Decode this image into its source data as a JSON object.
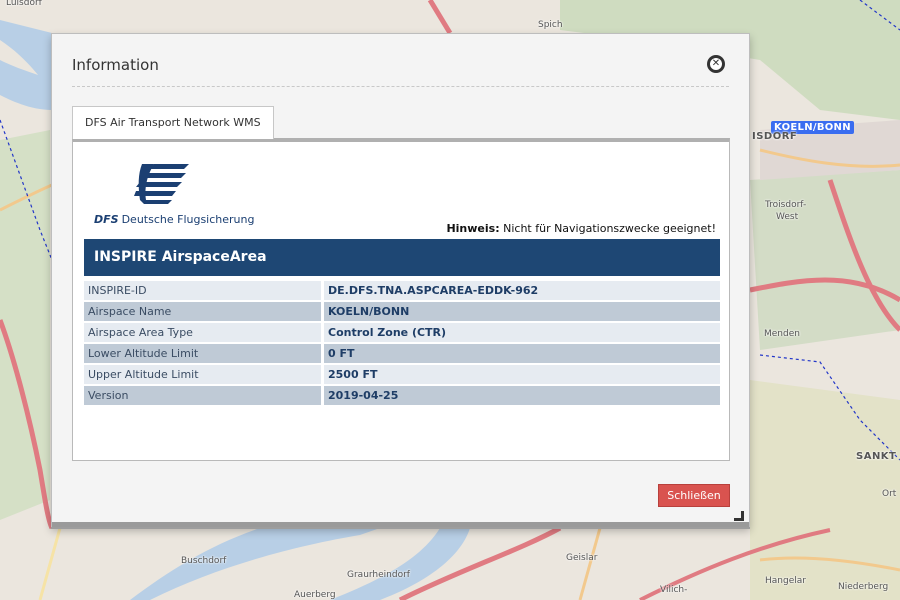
{
  "map": {
    "labels": {
      "luisdorf": "Luisdorf",
      "spich": "Spich",
      "koeln_bonn": "KOELN/BONN",
      "isdorf": "ISDORF",
      "troisdorf_west": "Troisdorf-",
      "troisdorf_west2": "West",
      "menden": "Menden",
      "sankt": "SANKT A",
      "ort": "Ort",
      "buschdorf": "Buschdorf",
      "graurheindorf": "Graurheindorf",
      "auerberg": "Auerberg",
      "geislar": "Geislar",
      "vilich": "Vilich-",
      "hangelar": "Hangelar",
      "niederberg": "Niederberg"
    }
  },
  "dialog": {
    "title": "Information",
    "tab_label": "DFS Air Transport Network WMS",
    "logo_text_bold": "DFS",
    "logo_text": "Deutsche Flugsicherung",
    "hint_label": "Hinweis:",
    "hint_text": " Nicht für Navigationszwecke geeignet!",
    "header": "INSPIRE AirspaceArea",
    "rows": [
      {
        "key": "INSPIRE-ID",
        "value": "DE.DFS.TNA.ASPCAREA-EDDK-962"
      },
      {
        "key": "Airspace Name",
        "value": "KOELN/BONN"
      },
      {
        "key": "Airspace Area Type",
        "value": "Control Zone (CTR)"
      },
      {
        "key": "Lower Altitude Limit",
        "value": "0 FT"
      },
      {
        "key": "Upper Altitude Limit",
        "value": "2500 FT"
      },
      {
        "key": "Version",
        "value": "2019-04-25"
      }
    ],
    "close_button": "Schließen"
  }
}
